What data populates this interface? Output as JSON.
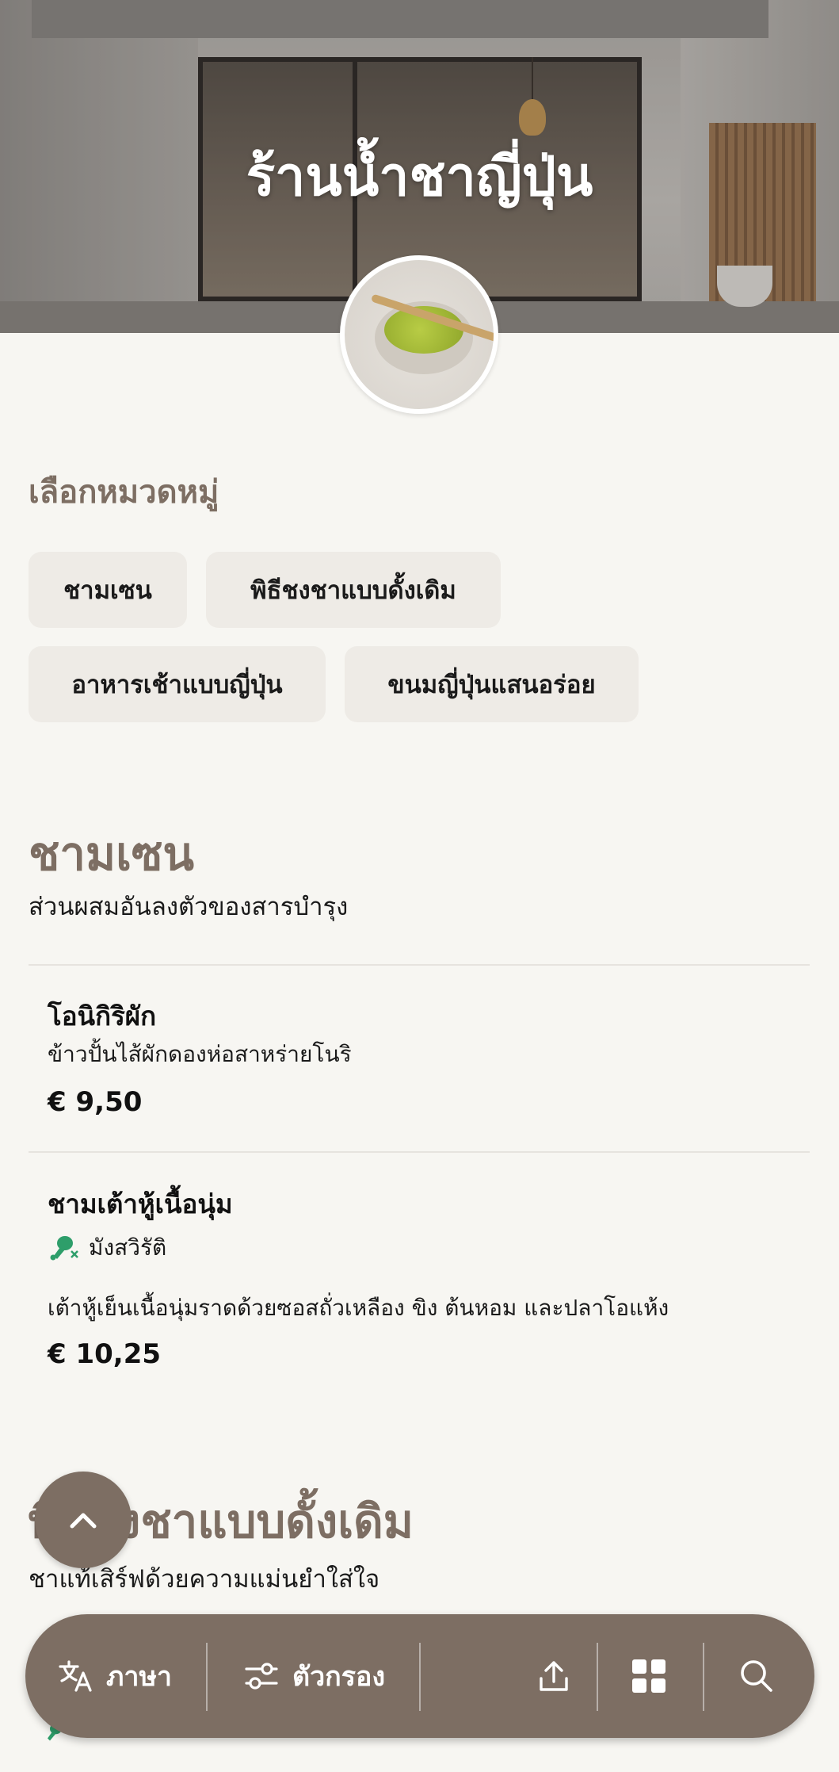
{
  "hero": {
    "title": "ร้านน้ำชาญี่ปุ่น"
  },
  "categories": {
    "label": "เลือกหมวดหมู่",
    "chips": [
      "ชามเซน",
      "พิธีชงชาแบบดั้งเดิม",
      "อาหารเช้าแบบญี่ปุ่น",
      "ขนมญี่ปุ่นแสนอร่อย"
    ]
  },
  "sections": [
    {
      "title": "ชามเซน",
      "description": "ส่วนผสมอันลงตัวของสารบำรุง",
      "items": [
        {
          "name": "โอนิกิริผัก",
          "description": "ข้าวปั้นไส้ผักดองห่อสาหร่ายโนริ",
          "price": "€ 9,50"
        },
        {
          "name": "ชามเต้าหู้เนื้อนุ่ม",
          "badge": "มังสวิรัติ",
          "badge_icon": "vegetarian-drumstick-crossed-icon",
          "description": "เต้าหู้เย็นเนื้อนุ่มราดด้วยซอสถั่วเหลือง ขิง ต้นหอม และปลาโอแห้ง",
          "price": "€ 10,25"
        }
      ]
    },
    {
      "title": "พิธีชงชาแบบดั้งเดิม",
      "description": "ชาแท้เสิร์ฟด้วยความแม่นยำใส่ใจ"
    }
  ],
  "bottom_bar": {
    "language_label": "ภาษา",
    "filter_label": "ตัวกรอง",
    "icons": [
      "translate-icon",
      "filter-icon",
      "share-icon",
      "grid-icon",
      "search-icon"
    ]
  },
  "colors": {
    "accent": "#7d6e63",
    "background": "#f7f6f2",
    "chip": "#eeebe6",
    "vegetarian_green": "#2e9e6a"
  }
}
